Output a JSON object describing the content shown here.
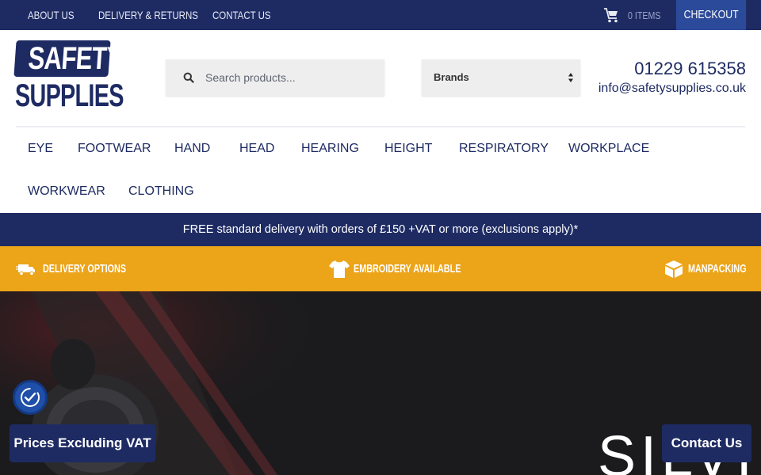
{
  "topbar": {
    "links": [
      "ABOUT US",
      "DELIVERY & RETURNS",
      "CONTACT US"
    ],
    "cart_label": "0 ITEMS",
    "checkout_label": "CHECKOUT"
  },
  "logo": {
    "line1": "SAFETY",
    "line2": "SUPPLIES"
  },
  "search": {
    "placeholder": "Search products..."
  },
  "brands_select": {
    "selected": "Brands"
  },
  "contact": {
    "phone": "01229 615358",
    "email": "info@safetysupplies.co.uk"
  },
  "nav": {
    "items": [
      "EYE",
      "FOOTWEAR",
      "HAND",
      "HEAD",
      "HEARING",
      "HEIGHT",
      "RESPIRATORY",
      "WORKPLACE",
      "WORKWEAR",
      "CLOTHING"
    ]
  },
  "free_delivery": "FREE standard delivery with orders of £150 +VAT or more (exclusions apply)*",
  "features": [
    {
      "label": "DELIVERY OPTIONS",
      "icon": "truck-icon"
    },
    {
      "label": "EMBROIDERY AVAILABLE",
      "icon": "tshirt-icon"
    },
    {
      "label": "MANPACKING",
      "icon": "box-icon"
    }
  ],
  "hero": {
    "partial_text": "SILVI"
  },
  "floating": {
    "vat_label": "Prices Excluding VAT",
    "contact_label": "Contact Us",
    "accessibility_icon": "accessibility-icon"
  },
  "colors": {
    "navy": "#1e2b63",
    "orange": "#eca418",
    "checkout_blue": "#2c4a9a"
  }
}
